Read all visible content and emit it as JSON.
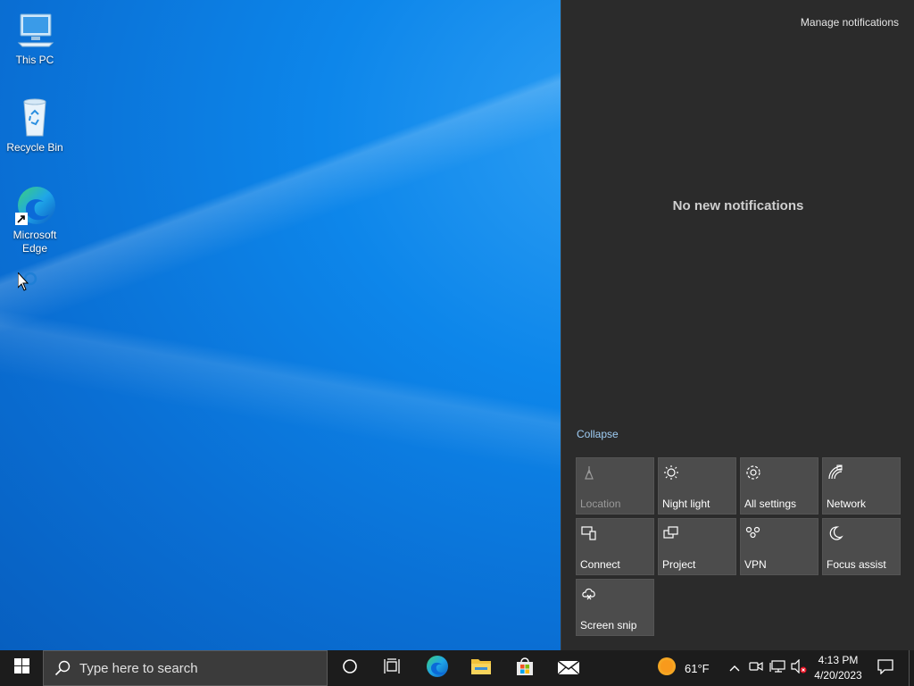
{
  "desktop": {
    "icons": [
      {
        "label": "This PC"
      },
      {
        "label": "Recycle Bin"
      },
      {
        "label": "Microsoft Edge"
      }
    ]
  },
  "action_center": {
    "manage_label": "Manage notifications",
    "empty_message": "No new notifications",
    "collapse_label": "Collapse",
    "tiles": [
      {
        "label": "Location",
        "icon": "location-icon",
        "enabled": false
      },
      {
        "label": "Night light",
        "icon": "brightness-icon",
        "enabled": true
      },
      {
        "label": "All settings",
        "icon": "gear-icon",
        "enabled": true
      },
      {
        "label": "Network",
        "icon": "network-icon",
        "enabled": true
      },
      {
        "label": "Connect",
        "icon": "connect-icon",
        "enabled": true
      },
      {
        "label": "Project",
        "icon": "project-icon",
        "enabled": true
      },
      {
        "label": "VPN",
        "icon": "vpn-icon",
        "enabled": true
      },
      {
        "label": "Focus assist",
        "icon": "moon-icon",
        "enabled": true
      },
      {
        "label": "Screen snip",
        "icon": "snip-icon",
        "enabled": true
      }
    ]
  },
  "taskbar": {
    "search_placeholder": "Type here to search",
    "weather": {
      "temp": "61°F",
      "icon": "sun-icon"
    },
    "clock": {
      "time": "4:13 PM",
      "date": "4/20/2023"
    }
  },
  "colors": {
    "accent": "#0a74d8",
    "panel": "#2b2b2b",
    "tile": "#4c4c4c",
    "taskbar": "#1c1c1c"
  }
}
